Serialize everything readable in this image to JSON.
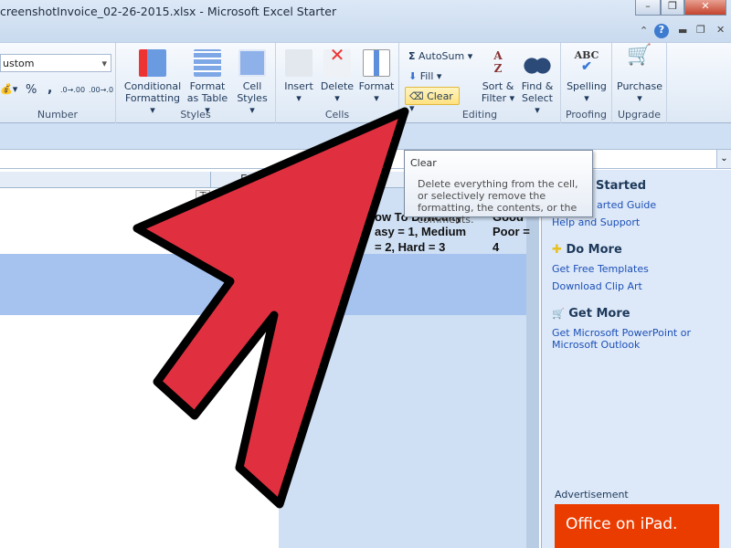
{
  "window": {
    "title": "creenshotInvoice_02-26-2015.xlsx  -  Microsoft Excel Starter",
    "minimize": "–",
    "restore": "❐",
    "close": "✕"
  },
  "ribbon": {
    "number": {
      "format_value": "ustom",
      "percent": "%",
      "comma": ",",
      "inc_decimal": ".0→.00",
      "dec_decimal": ".00→.0",
      "label": "Number"
    },
    "styles": {
      "conditional": "Conditional",
      "conditional2": "Formatting ▾",
      "format_table": "Format",
      "format_table2": "as Table ▾",
      "cell_styles": "Cell",
      "cell_styles2": "Styles ▾",
      "label": "Styles"
    },
    "cells": {
      "insert": "Insert",
      "delete": "Delete",
      "format": "Format",
      "label": "Cells"
    },
    "editing": {
      "autosum": "AutoSum ▾",
      "fill": "Fill ▾",
      "clear": "Clear ▾",
      "sort": "Sort &",
      "sort2": "Filter ▾",
      "find": "Find &",
      "find2": "Select ▾",
      "label": "Editing"
    },
    "proofing": {
      "spelling": "Spelling",
      "label": "Proofing"
    },
    "upgrade": {
      "purchase": "Purchase",
      "label": "Upgrade"
    }
  },
  "sheet": {
    "column_e": "E",
    "cells": [
      "ow To Difficulty",
      "asy = 1, Medium",
      "= 2, Hard = 3",
      "Good",
      "Poor =",
      "4"
    ]
  },
  "tooltip": {
    "title": "Clear",
    "body": "Delete everything from the cell, or selectively remove the formatting, the contents, or the comments."
  },
  "task_pane": {
    "getting_started": "Started",
    "links1": [
      "arted Guide",
      "Help and Support"
    ],
    "do_more": "Do More",
    "links2": [
      "Get Free Templates",
      "Download Clip Art"
    ],
    "get_more": "Get More",
    "links3": [
      "Get Microsoft PowerPoint or Microsoft Outlook"
    ],
    "ad_label": "Advertisement",
    "ad_text": "Office on iPad."
  },
  "colors": {
    "arrow": "#e03040",
    "selection": "#a6c3f0",
    "ad": "#eb3c00"
  }
}
